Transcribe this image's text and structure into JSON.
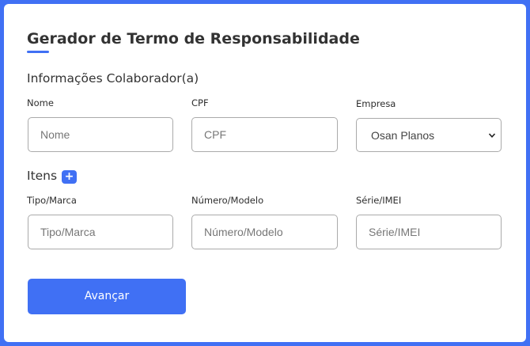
{
  "page": {
    "title": "Gerador de Termo de Responsabilidade"
  },
  "collaborator_section": {
    "title": "Informações Colaborador(a)",
    "fields": {
      "nome": {
        "label": "Nome",
        "placeholder": "Nome",
        "value": ""
      },
      "cpf": {
        "label": "CPF",
        "placeholder": "CPF",
        "value": ""
      },
      "empresa": {
        "label": "Empresa",
        "selected": "Osan Planos"
      }
    }
  },
  "items_section": {
    "title": "Itens",
    "add_button": "+",
    "fields": {
      "tipo": {
        "label": "Tipo/Marca",
        "placeholder": "Tipo/Marca",
        "value": ""
      },
      "numero": {
        "label": "Número/Modelo",
        "placeholder": "Número/Modelo",
        "value": ""
      },
      "serie": {
        "label": "Série/IMEI",
        "placeholder": "Série/IMEI",
        "value": ""
      }
    }
  },
  "actions": {
    "submit_label": "Avançar"
  },
  "colors": {
    "accent": "#4070f4",
    "background": "#4070f4",
    "card": "#ffffff"
  },
  "icons": {
    "select_arrow": "chevron-down-icon",
    "add": "plus-icon"
  }
}
